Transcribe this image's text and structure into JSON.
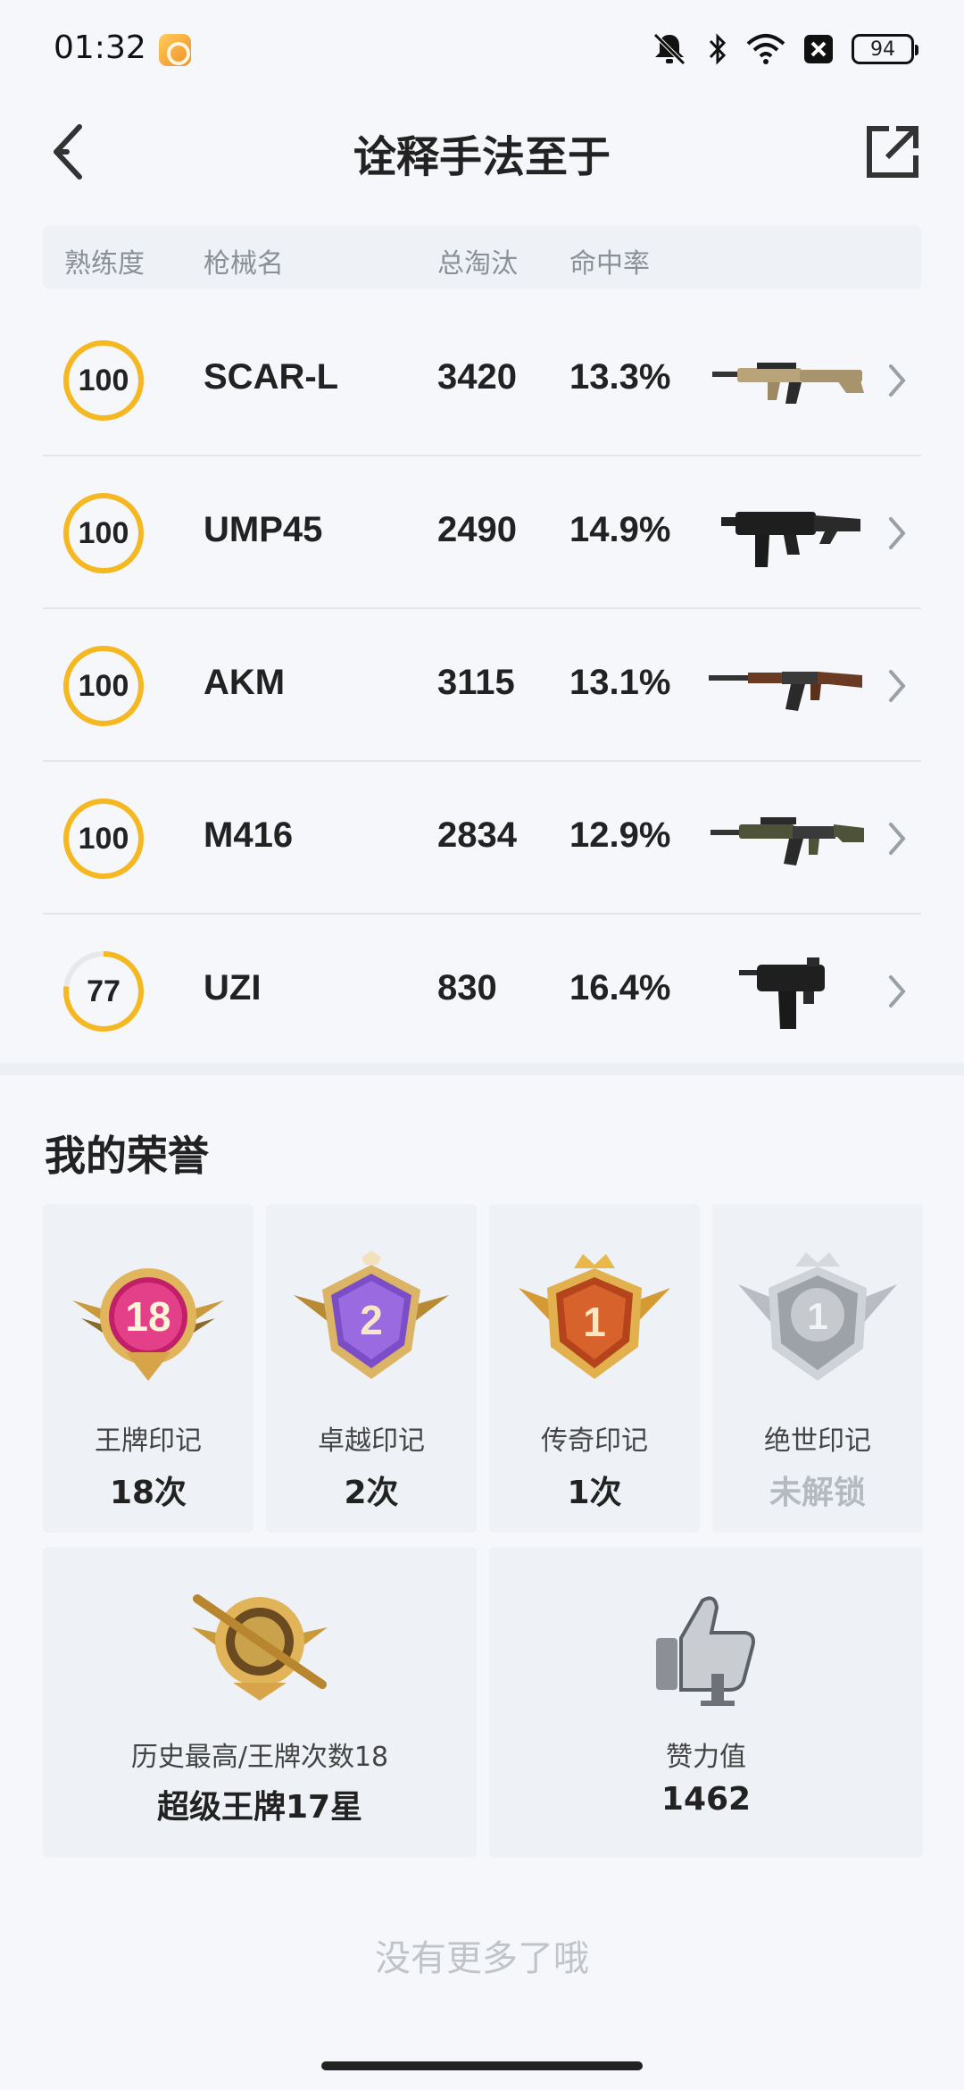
{
  "status_bar": {
    "time": "01:32",
    "battery": "94",
    "icons": [
      "app-icon",
      "mute-icon",
      "bluetooth-icon",
      "wifi-icon",
      "close-box-icon",
      "battery-icon"
    ]
  },
  "header": {
    "title": "诠释手法至于",
    "back_icon": "chevron-left-icon",
    "share_icon": "share-external-icon"
  },
  "table": {
    "headers": {
      "mastery": "熟练度",
      "name": "枪械名",
      "kills": "总淘汰",
      "hit_rate": "命中率"
    },
    "rows": [
      {
        "mastery": "100",
        "mastery_level": 1.0,
        "name": "SCAR-L",
        "kills": "3420",
        "hit_rate": "13.3%",
        "image": "scar-l-rifle"
      },
      {
        "mastery": "100",
        "mastery_level": 1.0,
        "name": "UMP45",
        "kills": "2490",
        "hit_rate": "14.9%",
        "image": "ump45-smg"
      },
      {
        "mastery": "100",
        "mastery_level": 1.0,
        "name": "AKM",
        "kills": "3115",
        "hit_rate": "13.1%",
        "image": "akm-rifle"
      },
      {
        "mastery": "100",
        "mastery_level": 1.0,
        "name": "M416",
        "kills": "2834",
        "hit_rate": "12.9%",
        "image": "m416-rifle"
      },
      {
        "mastery": "77",
        "mastery_level": 0.77,
        "name": "UZI",
        "kills": "830",
        "hit_rate": "16.4%",
        "image": "uzi-smg"
      }
    ]
  },
  "honors": {
    "title": "我的荣誉",
    "badges": [
      {
        "label": "王牌印记",
        "value": "18次",
        "badge_number": "18",
        "icon": "ace-mark-badge",
        "locked": false
      },
      {
        "label": "卓越印记",
        "value": "2次",
        "badge_number": "2",
        "icon": "excellence-mark-badge",
        "locked": false
      },
      {
        "label": "传奇印记",
        "value": "1次",
        "badge_number": "1",
        "icon": "legend-mark-badge",
        "locked": false
      },
      {
        "label": "绝世印记",
        "value": "未解锁",
        "badge_number": "1",
        "icon": "peerless-mark-badge",
        "locked": true
      }
    ],
    "highest": {
      "label": "历史最高/王牌次数18",
      "value": "超级王牌17星",
      "icon": "conqueror-tier-badge"
    },
    "likes": {
      "label": "赞力值",
      "value": "1462",
      "icon": "thumbs-up-icon"
    }
  },
  "footer": {
    "no_more": "没有更多了哦"
  },
  "colors": {
    "background": "#f5f7fa",
    "card": "#eef1f5",
    "mastery_ring": "#f5b820",
    "gold": "#d9a640",
    "muted_text": "#8a8f99"
  }
}
